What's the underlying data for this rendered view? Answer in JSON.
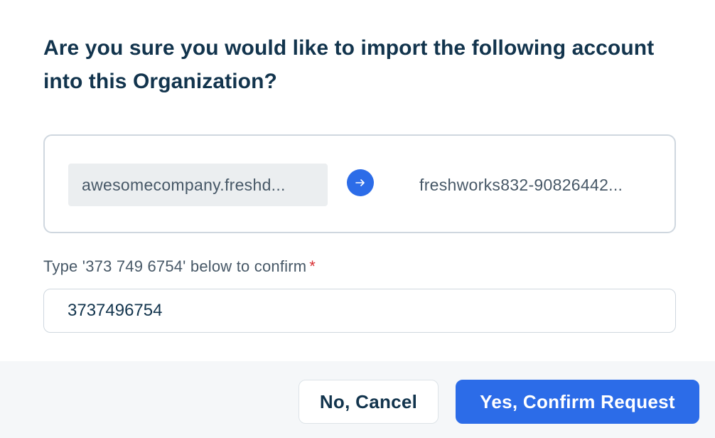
{
  "dialog": {
    "title": "Are you sure you would like to import the following account into this Organization?"
  },
  "accounts": {
    "source": "awesomecompany.freshd...",
    "target": "freshworks832-90826442...",
    "arrow_icon": "arrow-right-icon"
  },
  "confirmation": {
    "label": "Type '373 749 6754' below to confirm",
    "required_marker": "*",
    "input_value": "3737496754"
  },
  "footer": {
    "cancel_label": "No, Cancel",
    "confirm_label": "Yes, Confirm Request"
  },
  "colors": {
    "primary": "#2c6ce8",
    "heading": "#12344d",
    "required": "#d72d30"
  }
}
